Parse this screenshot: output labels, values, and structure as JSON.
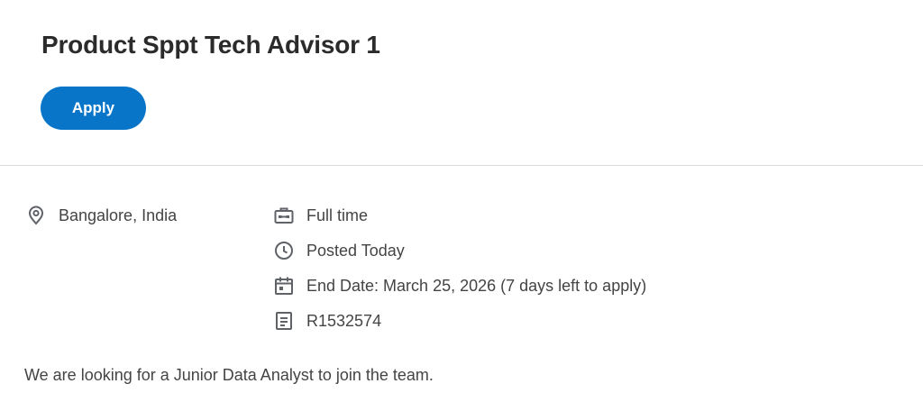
{
  "job": {
    "title": "Product Sppt Tech Advisor 1",
    "apply_label": "Apply",
    "location": "Bangalore, India",
    "time_type": "Full time",
    "posted": "Posted Today",
    "end_date": "End Date: March 25, 2026 (7 days left to apply)",
    "requisition_id": "R1532574",
    "description": "We are looking for a Junior Data Analyst to join the team."
  },
  "icons": {
    "location": "location-pin-icon",
    "time_type": "briefcase-icon",
    "posted": "clock-icon",
    "end_date": "calendar-icon",
    "requisition_id": "document-icon"
  },
  "colors": {
    "accent": "#0875c9",
    "icon": "#5f6368",
    "title": "#2b2b2b",
    "text": "#444444",
    "divider": "#dcdcdc"
  }
}
